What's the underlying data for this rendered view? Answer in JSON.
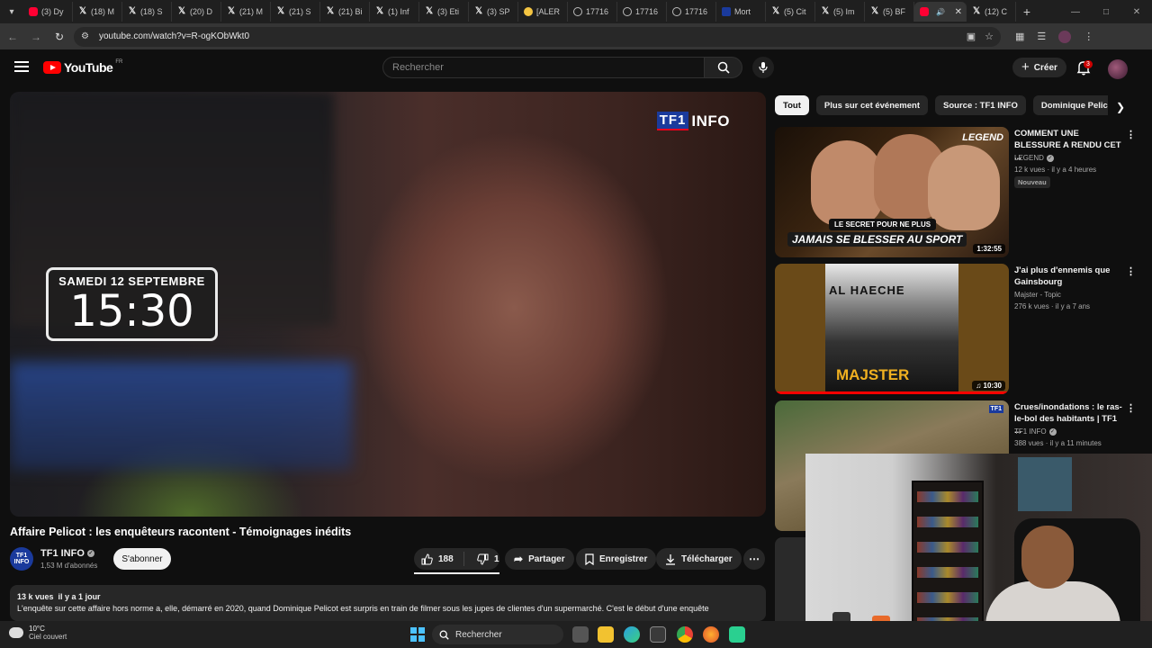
{
  "browser": {
    "tabs": [
      {
        "label": "(3) Dy",
        "icon": "youtube"
      },
      {
        "label": "(18) M",
        "icon": "x"
      },
      {
        "label": "(18) S",
        "icon": "x"
      },
      {
        "label": "(20) D",
        "icon": "x"
      },
      {
        "label": "(21) M",
        "icon": "x"
      },
      {
        "label": "(21) S",
        "icon": "x"
      },
      {
        "label": "(21) Bi",
        "icon": "x"
      },
      {
        "label": "(1) Inf",
        "icon": "x"
      },
      {
        "label": "(3) Eti",
        "icon": "x"
      },
      {
        "label": "(3) SP",
        "icon": "x"
      },
      {
        "label": "[ALER",
        "icon": "emoji"
      },
      {
        "label": "17716",
        "icon": "globe"
      },
      {
        "label": "17716",
        "icon": "globe"
      },
      {
        "label": "17716",
        "icon": "globe"
      },
      {
        "label": "Mort",
        "icon": "news"
      },
      {
        "label": "(5) Cit",
        "icon": "x"
      },
      {
        "label": "(5) Im",
        "icon": "x"
      },
      {
        "label": "(5) BF",
        "icon": "x"
      },
      {
        "label": "",
        "icon": "youtube",
        "active": true
      },
      {
        "label": "(12) C",
        "icon": "x"
      }
    ],
    "url": "youtube.com/watch?v=R-ogKObWkt0"
  },
  "header": {
    "logo_text": "YouTube",
    "country": "FR",
    "search_placeholder": "Rechercher",
    "create_label": "Créer",
    "notifications_count": "3"
  },
  "video": {
    "overlay_date": "SAMEDI 12 SEPTEMBRE",
    "overlay_time": "15:30",
    "logo_box": "TF1",
    "logo_info": "INFO",
    "title": "Affaire Pelicot : les enquêteurs racontent - Témoignages inédits",
    "channel": "TF1 INFO",
    "channel_avatar_top": "TF1",
    "channel_avatar_bottom": "INFO",
    "subscribers": "1,53 M d'abonnés",
    "subscribe_label": "S'abonner",
    "likes": "188",
    "dislikes": "1",
    "share_label": "Partager",
    "save_label": "Enregistrer",
    "download_label": "Télécharger",
    "views": "13 k vues",
    "age": "il y a 1 jour",
    "description": "L'enquête sur cette affaire hors norme a, elle, démarré en 2020, quand Dominique Pelicot est surpris en train de filmer sous les jupes de clientes d'un supermarché. C'est le début d'une enquête"
  },
  "chips": [
    "Tout",
    "Plus sur cet événement",
    "Source : TF1 INFO",
    "Dominique Pelicot"
  ],
  "recommendations": [
    {
      "title": "COMMENT UNE BLESSURE A RENDU CET ...",
      "channel": "LEGEND",
      "verified": true,
      "meta": "12 k vues · il y a 4 heures",
      "badge": "Nouveau",
      "duration": "1:32:55",
      "thumb_brand": "LEGEND",
      "thumb_cap1": "LE SECRET POUR NE PLUS",
      "thumb_cap2": "JAMAIS SE BLESSER AU SPORT"
    },
    {
      "title": "J'ai plus d'ennemis que Gainsbourg",
      "channel": "Majster - Topic",
      "verified": false,
      "meta": "276 k vues · il y a 7 ans",
      "duration": "10:30",
      "thumb_sign": "AL HAECHE",
      "thumb_name": "MAJSTER"
    },
    {
      "title": "Crues/inondations : le ras-le-bol des habitants | TF1 ...",
      "channel": "TF1 INFO",
      "verified": true,
      "meta": "388 vues · il y a 11 minutes",
      "thumb_logo": "TF1"
    }
  ],
  "taskbar": {
    "temperature": "10°C",
    "weather": "Ciel couvert",
    "search_label": "Rechercher"
  }
}
